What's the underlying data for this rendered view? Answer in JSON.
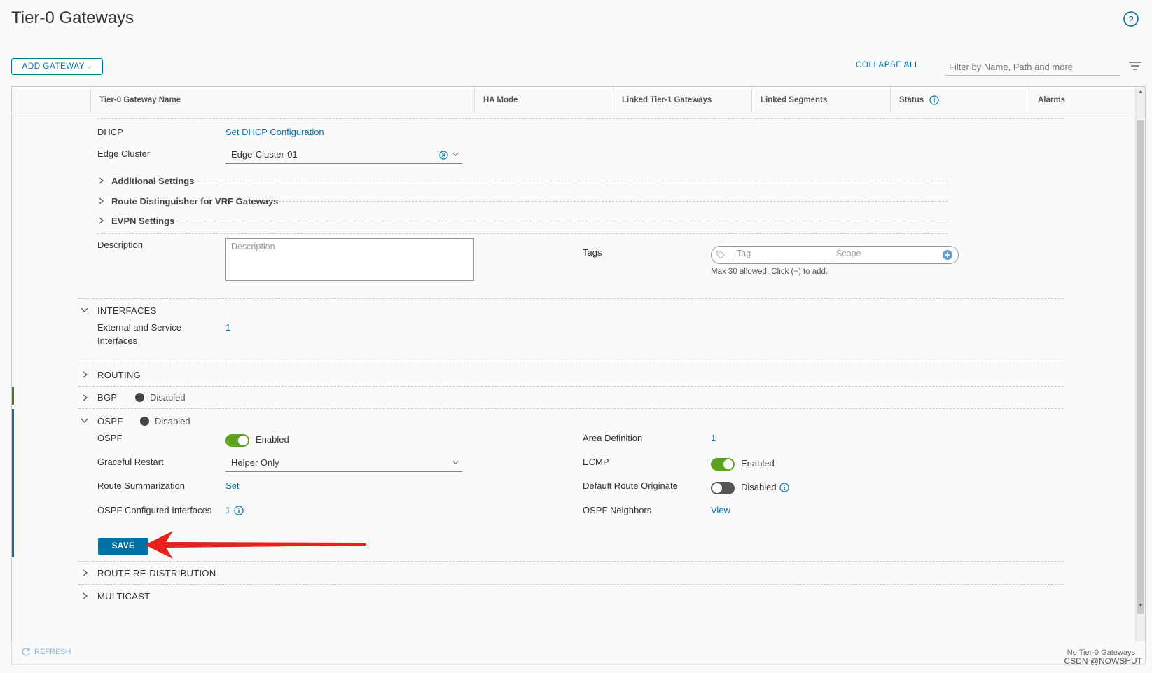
{
  "page": {
    "title": "Tier-0 Gateways",
    "help_icon": "help-circle-icon"
  },
  "toolbar": {
    "add_gateway": "ADD GATEWAY",
    "collapse_all": "COLLAPSE ALL",
    "filter_placeholder": "Filter by Name, Path and more"
  },
  "columns": [
    "Tier-0 Gateway Name",
    "HA Mode",
    "Linked Tier-1 Gateways",
    "Linked Segments",
    "Status",
    "Alarms"
  ],
  "form": {
    "dhcp": {
      "label": "DHCP",
      "value": "Set DHCP Configuration"
    },
    "edge_cluster": {
      "label": "Edge Cluster",
      "value": "Edge-Cluster-01"
    },
    "additional_settings": "Additional Settings",
    "route_distinguisher": "Route Distinguisher for VRF Gateways",
    "evpn_settings": "EVPN Settings",
    "description": {
      "label": "Description",
      "placeholder": "Description"
    },
    "tags": {
      "label": "Tags",
      "tag_placeholder": "Tag",
      "scope_placeholder": "Scope",
      "hint": "Max 30 allowed. Click (+) to add."
    }
  },
  "interfaces": {
    "title": "INTERFACES",
    "label_line1": "External and Service",
    "label_line2": "Interfaces",
    "value": "1"
  },
  "routing": {
    "title": "ROUTING"
  },
  "bgp": {
    "title": "BGP",
    "status": "Disabled"
  },
  "ospf": {
    "title": "OSPF",
    "status": "Disabled",
    "ospf_label": "OSPF",
    "ospf_toggle": "Enabled",
    "ospf_on": true,
    "graceful_restart_label": "Graceful Restart",
    "graceful_restart_value": "Helper Only",
    "route_summarization_label": "Route Summarization",
    "route_summarization_value": "Set",
    "configured_interfaces_label": "OSPF Configured Interfaces",
    "configured_interfaces_value": "1",
    "area_definition_label": "Area Definition",
    "area_definition_value": "1",
    "ecmp_label": "ECMP",
    "ecmp_toggle": "Enabled",
    "ecmp_on": true,
    "default_route_label": "Default Route Originate",
    "default_route_toggle": "Disabled",
    "default_route_on": false,
    "neighbors_label": "OSPF Neighbors",
    "neighbors_value": "View",
    "save": "SAVE"
  },
  "route_redistribution": {
    "title": "ROUTE RE-DISTRIBUTION"
  },
  "multicast": {
    "title": "MULTICAST"
  },
  "footer": {
    "refresh": "REFRESH",
    "count": "No Tier-0 Gateways",
    "watermark": "CSDN @NOWSHUT"
  },
  "colors": {
    "accent": "#0072a3",
    "toggle_on": "#5aa220",
    "arrow": "#e8221b",
    "bgp_bar": "#3c8500"
  }
}
